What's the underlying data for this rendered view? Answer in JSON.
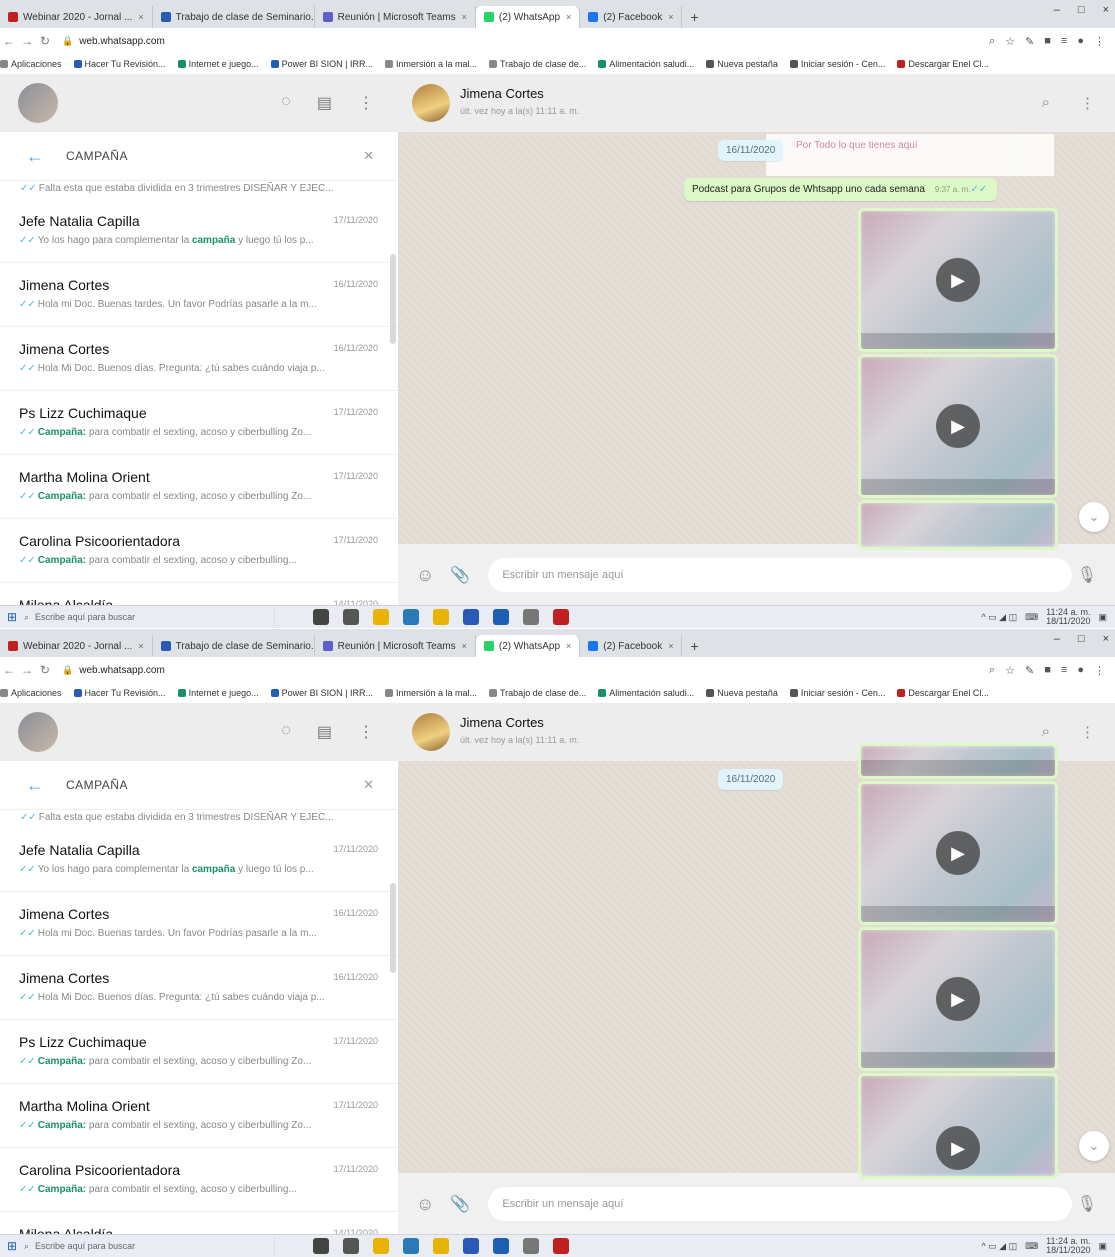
{
  "browser": {
    "tabs": [
      {
        "label": "Webinar 2020 - Jornal ... ",
        "color": "#c02020"
      },
      {
        "label": "Trabajo de clase de Seminario...",
        "color": "#2a5ab8"
      },
      {
        "label": "Reunión | Microsoft Teams",
        "color": "#5b5fc7"
      },
      {
        "label": "(2) WhatsApp",
        "color": "#25d366"
      },
      {
        "label": "(2) Facebook",
        "color": "#1877f2"
      }
    ],
    "new_tab": "+",
    "window_controls": [
      "–",
      "□",
      "×"
    ],
    "address": "web.whatsapp.com",
    "bookmarks": [
      {
        "label": "Aplicaciones",
        "color": "#888888"
      },
      {
        "label": "Hacer Tu Revisión...",
        "color": "#2a5ab8"
      },
      {
        "label": "Internet e juego...",
        "color": "#1a8f6c"
      },
      {
        "label": "Power BI SION | IRR...",
        "color": "#1e5fb4"
      },
      {
        "label": "Inmersión a la mal...",
        "color": "#888888"
      },
      {
        "label": "Trabajo de clase de...",
        "color": "#888888"
      },
      {
        "label": "Alimentación saludi...",
        "color": "#1a8f6c"
      },
      {
        "label": "Nueva pestaña",
        "color": "#555555"
      },
      {
        "label": "Iniciar sesión - Cen...",
        "color": "#555555"
      },
      {
        "label": "Descargar Enel Cl...",
        "color": "#c02020"
      }
    ]
  },
  "sidebar": {
    "search_query": "CAMPAÑA",
    "partial_preview": "Falta esta que estaba dividida en 3 trimestres DISEÑAR Y EJEC...",
    "chats": [
      {
        "name": "Jefe Natalia Capilla",
        "date": "17/11/2020",
        "preview_pre": "Yo los hago para complementar la ",
        "preview_bold": "campaña",
        "preview_post": " y luego tú los p..."
      },
      {
        "name": "Jimena Cortes",
        "date": "16/11/2020",
        "preview_pre": "Hola mi Doc. Buenas tardes. Un favor Podrías pasarle a la m...",
        "preview_bold": "",
        "preview_post": ""
      },
      {
        "name": "Jimena Cortes",
        "date": "16/11/2020",
        "preview_pre": "Hola Mi Doc. Buenos días. Pregunta: ¿tú sabes cuándo viaja p...",
        "preview_bold": "",
        "preview_post": ""
      },
      {
        "name": "Ps Lizz Cuchimaque",
        "date": "17/11/2020",
        "preview_pre": "",
        "preview_bold": "Campaña:",
        "preview_post": " para combatir el sexting, acoso y ciberbulling Zo..."
      },
      {
        "name": "Martha Molina Orient",
        "date": "17/11/2020",
        "preview_pre": "",
        "preview_bold": "Campaña:",
        "preview_post": " para combatir el sexting, acoso y ciberbulling Zo..."
      },
      {
        "name": "Carolina Psicoorientadora",
        "date": "17/11/2020",
        "preview_pre": "",
        "preview_bold": "Campaña:",
        "preview_post": " para combatir el sexting, acoso y ciberbulling..."
      },
      {
        "name": "Milena Alcaldía",
        "date": "14/11/2020",
        "preview_pre": "",
        "preview_bold": "",
        "preview_post": ""
      }
    ]
  },
  "conversation": {
    "contact_name": "Jimena Cortes",
    "contact_status": "últ. vez hoy a la(s) 11:11 a. m.",
    "date_chip": "16/11/2020",
    "sticker_text": "Por Todo lo que tienes aquí",
    "message_text": "Podcast para Grupos de Whtsapp uno cada semana",
    "message_time": "9:37 a. m.",
    "composer_placeholder": "Escribir un mensaje aquí"
  },
  "taskbar": {
    "search_placeholder": "Escribe aquí para buscar",
    "time": "11:24 a. m.",
    "date": "18/11/2020",
    "app_colors": [
      "#444444",
      "#555555",
      "#e8b400",
      "#2a7ab8",
      "#e8b400",
      "#2a5ab8",
      "#1e5fb4",
      "#777777",
      "#c02020"
    ]
  }
}
